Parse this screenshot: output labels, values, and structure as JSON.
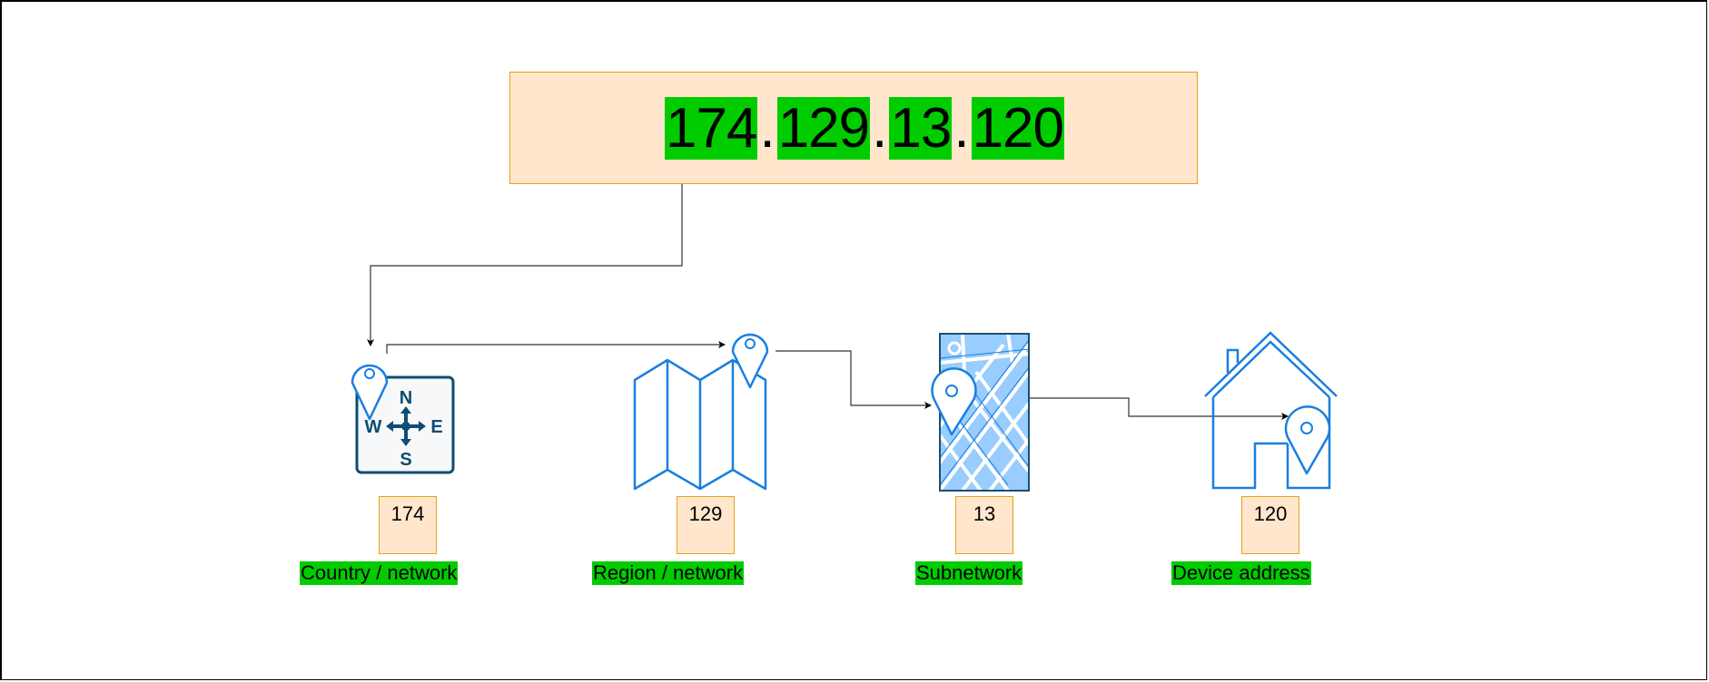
{
  "ip_address": {
    "octets": [
      "174",
      "129",
      "13",
      "120"
    ],
    "separator": "."
  },
  "stages": [
    {
      "icon": "compass-icon",
      "value": "174",
      "label": "Country / network"
    },
    {
      "icon": "folded-map-icon",
      "value": "129",
      "label": "Region / network"
    },
    {
      "icon": "street-map-icon",
      "value": "13",
      "label": "Subnetwork"
    },
    {
      "icon": "house-icon",
      "value": "120",
      "label": "Device address"
    }
  ],
  "compass": {
    "n": "N",
    "s": "S",
    "e": "E",
    "w": "W"
  },
  "colors": {
    "box_fill": "#ffe6cc",
    "box_stroke": "#e5a21a",
    "highlight": "#00cc00",
    "icon_blue": "#1a7fe0",
    "compass_navy": "#0e4d72",
    "map_fill": "#99ccff",
    "connector": "#333333"
  }
}
